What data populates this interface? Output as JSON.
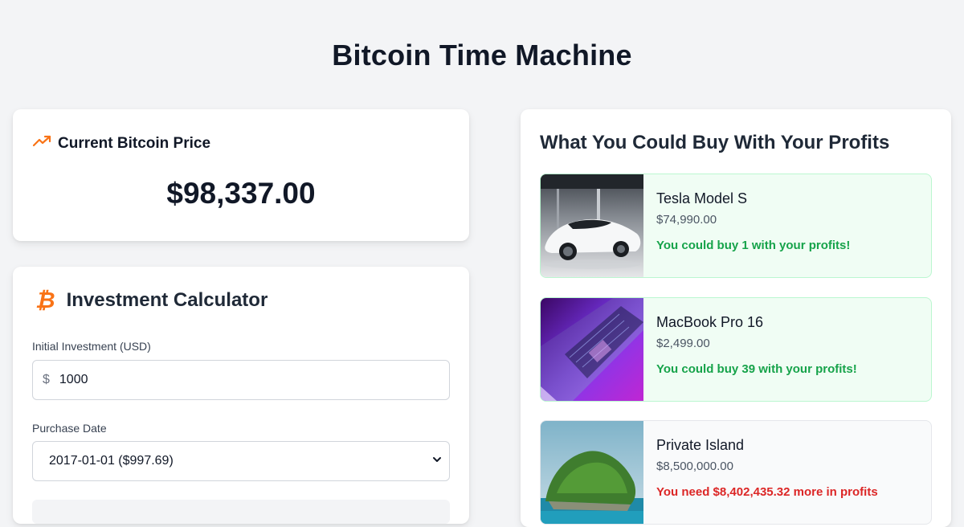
{
  "page": {
    "title": "Bitcoin Time Machine"
  },
  "price_card": {
    "icon": "trending-up-icon",
    "label": "Current Bitcoin Price",
    "value": "$98,337.00"
  },
  "calculator": {
    "icon": "bitcoin-icon",
    "icon_glyph": "₿",
    "title": "Investment Calculator",
    "investment_label": "Initial Investment (USD)",
    "investment_prefix": "$",
    "investment_value": "1000",
    "date_label": "Purchase Date",
    "date_value": "2017-01-01 ($997.69)"
  },
  "buy": {
    "title": "What You Could Buy With Your Profits",
    "items": [
      {
        "name": "Tesla Model S",
        "price": "$74,990.00",
        "message": "You could buy 1 with your profits!",
        "status": "affordable",
        "image": "white-sports-car"
      },
      {
        "name": "MacBook Pro 16",
        "price": "$2,499.00",
        "message": "You could buy 39 with your profits!",
        "status": "affordable",
        "image": "laptop-purple"
      },
      {
        "name": "Private Island",
        "price": "$8,500,000.00",
        "message": "You need $8,402,435.32 more in profits",
        "status": "unaffordable",
        "image": "green-island"
      }
    ]
  },
  "colors": {
    "accent": "#f97316",
    "success": "#16a34a",
    "danger": "#dc2626",
    "background": "#f3f4f6"
  }
}
